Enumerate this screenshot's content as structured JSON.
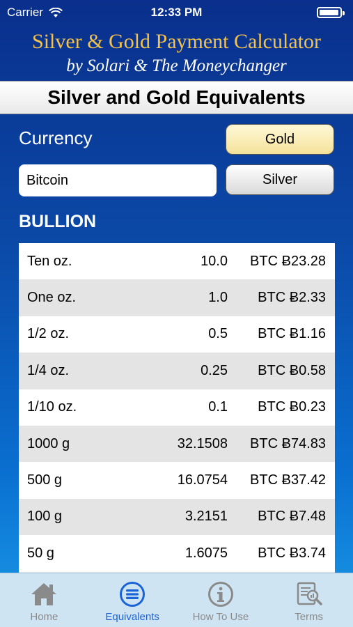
{
  "status_bar": {
    "carrier": "Carrier",
    "time": "12:33 PM",
    "battery_level": 0.9
  },
  "header": {
    "title": "Silver & Gold Payment Calculator",
    "subtitle": "by Solari & The Moneychanger"
  },
  "section_title": "Silver and Gold Equivalents",
  "currency": {
    "label": "Currency",
    "value": "Bitcoin"
  },
  "metal_buttons": {
    "gold": "Gold",
    "silver": "Silver"
  },
  "bullion_heading": "BULLION",
  "bullion_rows": [
    {
      "name": "Ten oz.",
      "oz": "10.0",
      "value": "BTC Ƀ23.28"
    },
    {
      "name": "One oz.",
      "oz": "1.0",
      "value": "BTC Ƀ2.33"
    },
    {
      "name": "1/2 oz.",
      "oz": "0.5",
      "value": "BTC Ƀ1.16"
    },
    {
      "name": "1/4 oz.",
      "oz": "0.25",
      "value": "BTC Ƀ0.58"
    },
    {
      "name": "1/10 oz.",
      "oz": "0.1",
      "value": "BTC Ƀ0.23"
    },
    {
      "name": "1000 g",
      "oz": "32.1508",
      "value": "BTC Ƀ74.83"
    },
    {
      "name": "500 g",
      "oz": "16.0754",
      "value": "BTC Ƀ37.42"
    },
    {
      "name": "100 g",
      "oz": "3.2151",
      "value": "BTC Ƀ7.48"
    },
    {
      "name": "50 g",
      "oz": "1.6075",
      "value": "BTC Ƀ3.74"
    },
    {
      "name": "",
      "oz": "",
      "value": ""
    }
  ],
  "tabs": [
    {
      "label": "Home",
      "icon": "home-icon",
      "active": false
    },
    {
      "label": "Equivalents",
      "icon": "equivalents-icon",
      "active": true
    },
    {
      "label": "How To Use",
      "icon": "info-icon",
      "active": false
    },
    {
      "label": "Terms",
      "icon": "terms-icon",
      "active": false
    }
  ],
  "colors": {
    "header_gold": "#f3c24a",
    "gold_button": "#f4e29a",
    "active_tab": "#1a64d8",
    "tab_bar_bg": "#cfe4f3"
  }
}
